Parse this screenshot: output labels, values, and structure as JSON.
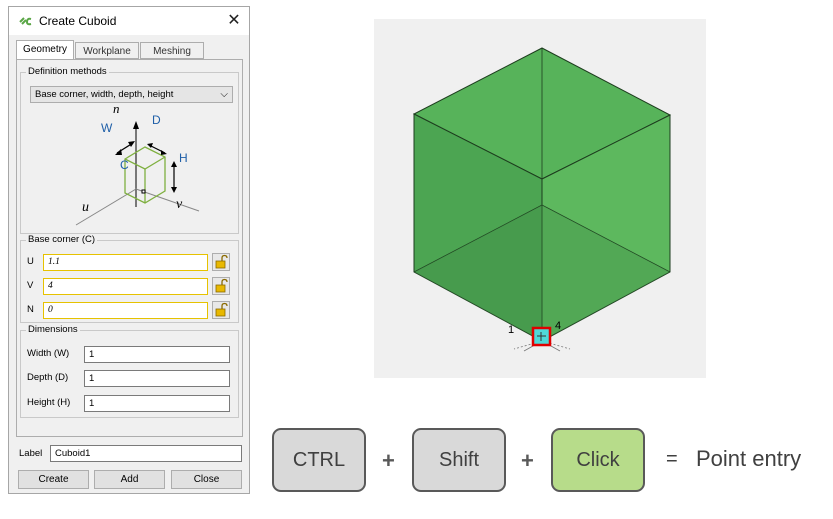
{
  "dialog": {
    "title": "Create Cuboid",
    "close_glyph": "✕",
    "app_icon": "cuboid-app-icon",
    "tabs": [
      "Geometry",
      "Workplane",
      "Meshing"
    ],
    "definition_methods": {
      "legend": "Definition methods",
      "selected": "Base corner, width, depth, height"
    },
    "diagram_labels": {
      "n": "n",
      "w": "W",
      "d": "D",
      "h": "H",
      "c": "C",
      "u": "u",
      "v": "v"
    },
    "base_corner": {
      "legend": "Base corner (C)",
      "fields": [
        {
          "label": "U",
          "value": "1.1"
        },
        {
          "label": "V",
          "value": "4"
        },
        {
          "label": "N",
          "value": "0"
        }
      ]
    },
    "dimensions": {
      "legend": "Dimensions",
      "fields": [
        {
          "label": "Width (W)",
          "value": "1"
        },
        {
          "label": "Depth (D)",
          "value": "1"
        },
        {
          "label": "Height (H)",
          "value": "1"
        }
      ]
    },
    "label_field": {
      "label": "Label",
      "value": "Cuboid1"
    },
    "buttons": {
      "create": "Create",
      "add": "Add",
      "close": "Close"
    }
  },
  "viewport": {
    "point_labels": [
      "1",
      "4"
    ],
    "colors": {
      "cube_top": "#57b35a",
      "cube_left": "#4ca552",
      "cube_right": "#5db85e",
      "highlight": "#e00000",
      "marker": "#4fd8d8"
    }
  },
  "shortcut": {
    "keys": [
      "CTRL",
      "Shift",
      "Click"
    ],
    "plus": "+",
    "equals": "=",
    "result": "Point entry",
    "colors": {
      "key": "#d9d9d9",
      "click_key": "#b7dc8a"
    }
  }
}
